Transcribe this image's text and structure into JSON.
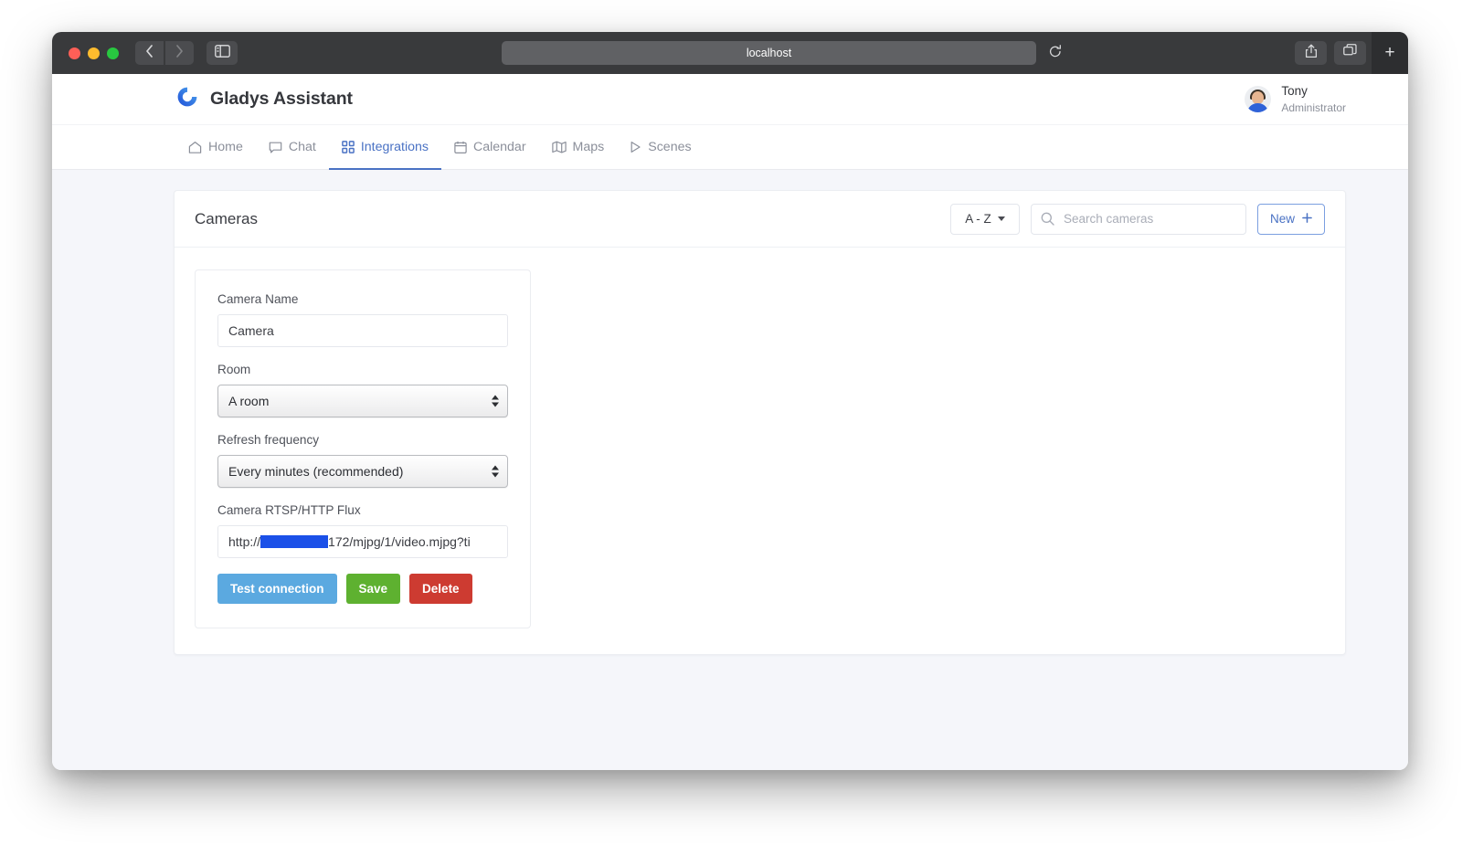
{
  "browser": {
    "url_text": "localhost",
    "traffic_lights": [
      "close",
      "minimize",
      "zoom"
    ],
    "back_icon": "chevron-left-icon",
    "forward_icon": "chevron-right-icon",
    "sidebar_icon": "sidebar-toggle-icon",
    "reload_icon": "reload-icon",
    "share_icon": "share-icon",
    "tabs_icon": "tab-overview-icon",
    "new_tab_label": "+"
  },
  "app_header": {
    "logo_icon": "gladys-logo-icon",
    "brand_title": "Gladys Assistant",
    "user": {
      "avatar_icon": "user-avatar",
      "name": "Tony",
      "role": "Administrator"
    }
  },
  "nav": {
    "items": [
      {
        "label": "Home",
        "icon": "home-icon",
        "active": false
      },
      {
        "label": "Chat",
        "icon": "chat-icon",
        "active": false
      },
      {
        "label": "Integrations",
        "icon": "grid-icon",
        "active": true
      },
      {
        "label": "Calendar",
        "icon": "calendar-icon",
        "active": false
      },
      {
        "label": "Maps",
        "icon": "map-icon",
        "active": false
      },
      {
        "label": "Scenes",
        "icon": "play-icon",
        "active": false
      }
    ],
    "accent_color": "#4a72c4"
  },
  "camera_page": {
    "title": "Cameras",
    "sort": {
      "label": "A - Z",
      "caret_icon": "caret-down-icon"
    },
    "search": {
      "icon": "search-icon",
      "placeholder": "Search cameras",
      "value": ""
    },
    "new_button": {
      "label": "New",
      "plus_icon": "plus-icon"
    },
    "form": {
      "name_field": {
        "label": "Camera Name",
        "value": "Camera"
      },
      "room_field": {
        "label": "Room",
        "value": "A room",
        "stepper_icon": "stepper-updown-icon"
      },
      "refresh_field": {
        "label": "Refresh frequency",
        "value": "Every minutes (recommended)",
        "stepper_icon": "stepper-updown-icon"
      },
      "flux_field": {
        "label": "Camera RTSP/HTTP Flux",
        "value_prefix": "http://",
        "redacted_icon": "redaction-block",
        "value_suffix": "172/mjpg/1/video.mjpg?ti"
      },
      "buttons": {
        "test": {
          "label": "Test connection",
          "color": "#5ba9e0"
        },
        "save": {
          "label": "Save",
          "color": "#5eb130"
        },
        "delete": {
          "label": "Delete",
          "color": "#cd3b31"
        }
      }
    }
  }
}
